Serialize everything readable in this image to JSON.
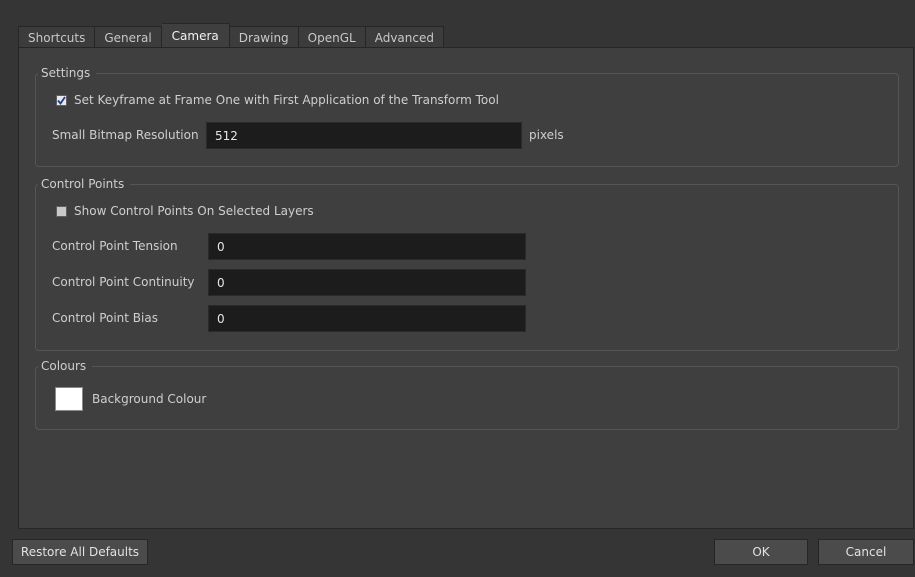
{
  "tabs": [
    {
      "label": "Shortcuts"
    },
    {
      "label": "General"
    },
    {
      "label": "Camera",
      "active": true
    },
    {
      "label": "Drawing"
    },
    {
      "label": "OpenGL"
    },
    {
      "label": "Advanced"
    }
  ],
  "settings": {
    "title": "Settings",
    "keyframe_checkbox_label": "Set Keyframe at Frame One with First Application of the Transform Tool",
    "keyframe_checked": true,
    "bitmap_label": "Small Bitmap Resolution",
    "bitmap_value": "512",
    "bitmap_unit": "pixels"
  },
  "control_points": {
    "title": "Control Points",
    "show_checkbox_label": "Show Control Points On Selected Layers",
    "show_checked": false,
    "tension_label": "Control Point Tension",
    "tension_value": "0",
    "continuity_label": "Control Point Continuity",
    "continuity_value": "0",
    "bias_label": "Control Point Bias",
    "bias_value": "0"
  },
  "colours": {
    "title": "Colours",
    "background_label": "Background Colour",
    "background_color": "#ffffff"
  },
  "buttons": {
    "restore": "Restore All Defaults",
    "ok": "OK",
    "cancel": "Cancel"
  }
}
